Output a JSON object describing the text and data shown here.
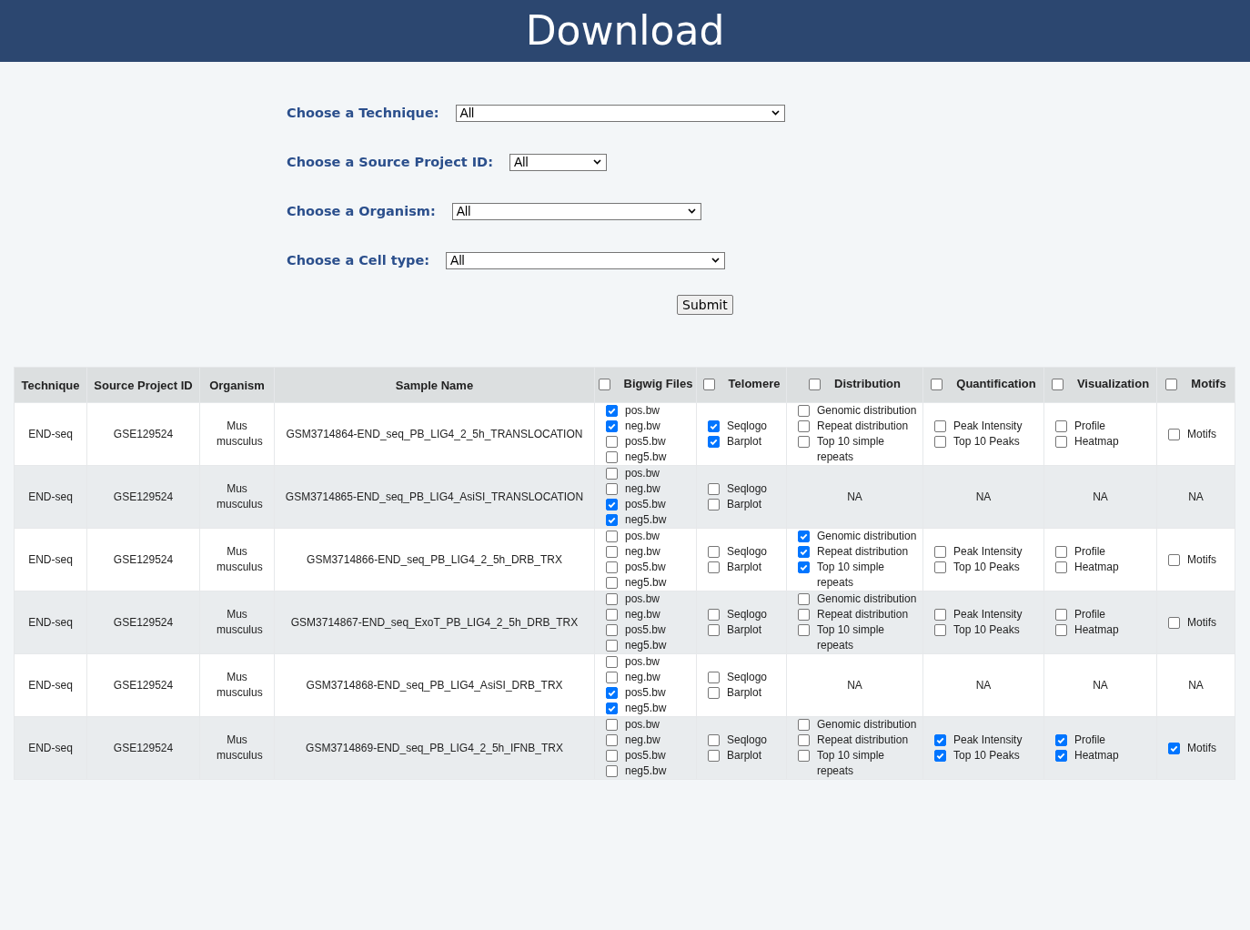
{
  "header": {
    "title": "Download"
  },
  "filters": [
    {
      "label": "Choose a Technique:",
      "value": "All"
    },
    {
      "label": "Choose a Source Project ID:",
      "value": "All"
    },
    {
      "label": "Choose a Organism:",
      "value": "All"
    },
    {
      "label": "Choose a Cell type:",
      "value": "All"
    }
  ],
  "submit": {
    "label": "Submit"
  },
  "table": {
    "columns": [
      {
        "label": "Technique",
        "kind": "text"
      },
      {
        "label": "Source Project ID",
        "kind": "text"
      },
      {
        "label": "Organism",
        "kind": "text"
      },
      {
        "label": "Sample Name",
        "kind": "text"
      },
      {
        "label": "Bigwig Files",
        "kind": "checkbox",
        "checked": false
      },
      {
        "label": "Telomere",
        "kind": "checkbox",
        "checked": false
      },
      {
        "label": "Distribution",
        "kind": "checkbox",
        "checked": false
      },
      {
        "label": "Quantification",
        "kind": "checkbox",
        "checked": false
      },
      {
        "label": "Visualization",
        "kind": "checkbox",
        "checked": false
      },
      {
        "label": "Motifs",
        "kind": "checkbox",
        "checked": false
      }
    ],
    "rows": [
      {
        "cells": [
          {
            "kind": "text",
            "text": "END-seq"
          },
          {
            "kind": "text",
            "text": "GSE129524"
          },
          {
            "kind": "text",
            "text": "Mus musculus"
          },
          {
            "kind": "text",
            "text": "GSM3714864-END_seq_PB_LIG4_2_5h_TRANSLOCATION"
          },
          {
            "kind": "options",
            "options": [
              {
                "label": "pos.bw",
                "checked": true
              },
              {
                "label": "neg.bw",
                "checked": true
              },
              {
                "label": "pos5.bw",
                "checked": false
              },
              {
                "label": "neg5.bw",
                "checked": false
              }
            ]
          },
          {
            "kind": "options",
            "options": [
              {
                "label": "Seqlogo",
                "checked": true
              },
              {
                "label": "Barplot",
                "checked": true
              }
            ]
          },
          {
            "kind": "options",
            "options": [
              {
                "label": "Genomic distribution",
                "checked": false
              },
              {
                "label": "Repeat distribution",
                "checked": false
              },
              {
                "label": "Top 10 simple repeats",
                "checked": false
              }
            ]
          },
          {
            "kind": "options",
            "options": [
              {
                "label": "Peak Intensity",
                "checked": false
              },
              {
                "label": "Top 10 Peaks",
                "checked": false
              }
            ]
          },
          {
            "kind": "options",
            "options": [
              {
                "label": "Profile",
                "checked": false
              },
              {
                "label": "Heatmap",
                "checked": false
              }
            ]
          },
          {
            "kind": "options",
            "options": [
              {
                "label": "Motifs",
                "checked": false
              }
            ]
          }
        ]
      },
      {
        "cells": [
          {
            "kind": "text",
            "text": "END-seq"
          },
          {
            "kind": "text",
            "text": "GSE129524"
          },
          {
            "kind": "text",
            "text": "Mus musculus"
          },
          {
            "kind": "text",
            "text": "GSM3714865-END_seq_PB_LIG4_AsiSI_TRANSLOCATION"
          },
          {
            "kind": "options",
            "options": [
              {
                "label": "pos.bw",
                "checked": false
              },
              {
                "label": "neg.bw",
                "checked": false
              },
              {
                "label": "pos5.bw",
                "checked": true
              },
              {
                "label": "neg5.bw",
                "checked": true
              }
            ]
          },
          {
            "kind": "options",
            "options": [
              {
                "label": "Seqlogo",
                "checked": false
              },
              {
                "label": "Barplot",
                "checked": false
              }
            ]
          },
          {
            "kind": "text",
            "text": "NA"
          },
          {
            "kind": "text",
            "text": "NA"
          },
          {
            "kind": "text",
            "text": "NA"
          },
          {
            "kind": "text",
            "text": "NA"
          }
        ]
      },
      {
        "cells": [
          {
            "kind": "text",
            "text": "END-seq"
          },
          {
            "kind": "text",
            "text": "GSE129524"
          },
          {
            "kind": "text",
            "text": "Mus musculus"
          },
          {
            "kind": "text",
            "text": "GSM3714866-END_seq_PB_LIG4_2_5h_DRB_TRX"
          },
          {
            "kind": "options",
            "options": [
              {
                "label": "pos.bw",
                "checked": false
              },
              {
                "label": "neg.bw",
                "checked": false
              },
              {
                "label": "pos5.bw",
                "checked": false
              },
              {
                "label": "neg5.bw",
                "checked": false
              }
            ]
          },
          {
            "kind": "options",
            "options": [
              {
                "label": "Seqlogo",
                "checked": false
              },
              {
                "label": "Barplot",
                "checked": false
              }
            ]
          },
          {
            "kind": "options",
            "options": [
              {
                "label": "Genomic distribution",
                "checked": true
              },
              {
                "label": "Repeat distribution",
                "checked": true
              },
              {
                "label": "Top 10 simple repeats",
                "checked": true
              }
            ]
          },
          {
            "kind": "options",
            "options": [
              {
                "label": "Peak Intensity",
                "checked": false
              },
              {
                "label": "Top 10 Peaks",
                "checked": false
              }
            ]
          },
          {
            "kind": "options",
            "options": [
              {
                "label": "Profile",
                "checked": false
              },
              {
                "label": "Heatmap",
                "checked": false
              }
            ]
          },
          {
            "kind": "options",
            "options": [
              {
                "label": "Motifs",
                "checked": false
              }
            ]
          }
        ]
      },
      {
        "cells": [
          {
            "kind": "text",
            "text": "END-seq"
          },
          {
            "kind": "text",
            "text": "GSE129524"
          },
          {
            "kind": "text",
            "text": "Mus musculus"
          },
          {
            "kind": "text",
            "text": "GSM3714867-END_seq_ExoT_PB_LIG4_2_5h_DRB_TRX"
          },
          {
            "kind": "options",
            "options": [
              {
                "label": "pos.bw",
                "checked": false
              },
              {
                "label": "neg.bw",
                "checked": false
              },
              {
                "label": "pos5.bw",
                "checked": false
              },
              {
                "label": "neg5.bw",
                "checked": false
              }
            ]
          },
          {
            "kind": "options",
            "options": [
              {
                "label": "Seqlogo",
                "checked": false
              },
              {
                "label": "Barplot",
                "checked": false
              }
            ]
          },
          {
            "kind": "options",
            "options": [
              {
                "label": "Genomic distribution",
                "checked": false
              },
              {
                "label": "Repeat distribution",
                "checked": false
              },
              {
                "label": "Top 10 simple repeats",
                "checked": false
              }
            ]
          },
          {
            "kind": "options",
            "options": [
              {
                "label": "Peak Intensity",
                "checked": false
              },
              {
                "label": "Top 10 Peaks",
                "checked": false
              }
            ]
          },
          {
            "kind": "options",
            "options": [
              {
                "label": "Profile",
                "checked": false
              },
              {
                "label": "Heatmap",
                "checked": false
              }
            ]
          },
          {
            "kind": "options",
            "options": [
              {
                "label": "Motifs",
                "checked": false
              }
            ]
          }
        ]
      },
      {
        "cells": [
          {
            "kind": "text",
            "text": "END-seq"
          },
          {
            "kind": "text",
            "text": "GSE129524"
          },
          {
            "kind": "text",
            "text": "Mus musculus"
          },
          {
            "kind": "text",
            "text": "GSM3714868-END_seq_PB_LIG4_AsiSI_DRB_TRX"
          },
          {
            "kind": "options",
            "options": [
              {
                "label": "pos.bw",
                "checked": false
              },
              {
                "label": "neg.bw",
                "checked": false
              },
              {
                "label": "pos5.bw",
                "checked": true
              },
              {
                "label": "neg5.bw",
                "checked": true
              }
            ]
          },
          {
            "kind": "options",
            "options": [
              {
                "label": "Seqlogo",
                "checked": false
              },
              {
                "label": "Barplot",
                "checked": false
              }
            ]
          },
          {
            "kind": "text",
            "text": "NA"
          },
          {
            "kind": "text",
            "text": "NA"
          },
          {
            "kind": "text",
            "text": "NA"
          },
          {
            "kind": "text",
            "text": "NA"
          }
        ]
      },
      {
        "cells": [
          {
            "kind": "text",
            "text": "END-seq"
          },
          {
            "kind": "text",
            "text": "GSE129524"
          },
          {
            "kind": "text",
            "text": "Mus musculus"
          },
          {
            "kind": "text",
            "text": "GSM3714869-END_seq_PB_LIG4_2_5h_IFNB_TRX"
          },
          {
            "kind": "options",
            "options": [
              {
                "label": "pos.bw",
                "checked": false
              },
              {
                "label": "neg.bw",
                "checked": false
              },
              {
                "label": "pos5.bw",
                "checked": false
              },
              {
                "label": "neg5.bw",
                "checked": false
              }
            ]
          },
          {
            "kind": "options",
            "options": [
              {
                "label": "Seqlogo",
                "checked": false
              },
              {
                "label": "Barplot",
                "checked": false
              }
            ]
          },
          {
            "kind": "options",
            "options": [
              {
                "label": "Genomic distribution",
                "checked": false
              },
              {
                "label": "Repeat distribution",
                "checked": false
              },
              {
                "label": "Top 10 simple repeats",
                "checked": false
              }
            ]
          },
          {
            "kind": "options",
            "options": [
              {
                "label": "Peak Intensity",
                "checked": true
              },
              {
                "label": "Top 10 Peaks",
                "checked": true
              }
            ]
          },
          {
            "kind": "options",
            "options": [
              {
                "label": "Profile",
                "checked": true
              },
              {
                "label": "Heatmap",
                "checked": true
              }
            ]
          },
          {
            "kind": "options",
            "options": [
              {
                "label": "Motifs",
                "checked": true
              }
            ]
          }
        ]
      }
    ]
  }
}
